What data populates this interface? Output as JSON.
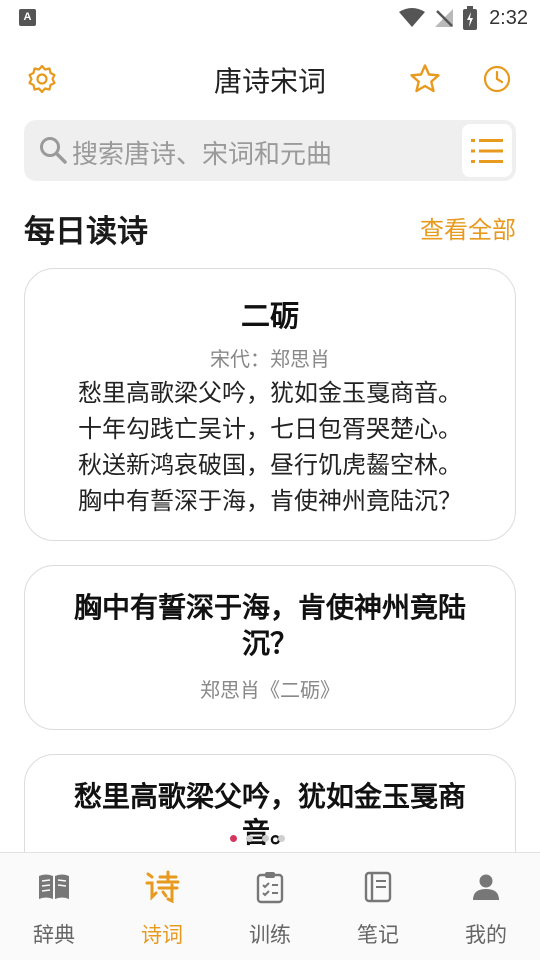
{
  "status_bar": {
    "time": "2:32",
    "left_badge": "A"
  },
  "app_bar": {
    "title": "唐诗宋词"
  },
  "search": {
    "placeholder": "搜索唐诗、宋词和元曲"
  },
  "section": {
    "heading": "每日读诗",
    "view_all": "查看全部"
  },
  "daily_poem": {
    "title": "二砺",
    "author_line": "宋代：郑思肖",
    "lines": [
      "愁里高歌梁父吟，犹如金玉戛商音。",
      "十年勾践亡吴计，七日包胥哭楚心。",
      "秋送新鸿哀破国，昼行饥虎齧空林。",
      "胸中有誓深于海，肯使神州竟陆沉？"
    ]
  },
  "quote_cards": [
    {
      "quote": "胸中有誓深于海，肯使神州竟陆沉？",
      "source": "郑思肖《二砺》"
    },
    {
      "quote": "愁里高歌梁父吟，犹如金玉戛商音。"
    }
  ],
  "carousel": {
    "pages": 4,
    "active_index": 0
  },
  "bottom_nav": {
    "items": [
      {
        "label": "辞典",
        "icon": "book-icon"
      },
      {
        "label": "诗词",
        "icon": "poem-icon",
        "active": true
      },
      {
        "label": "训练",
        "icon": "clipboard-icon"
      },
      {
        "label": "笔记",
        "icon": "notebook-icon"
      },
      {
        "label": "我的",
        "icon": "person-icon"
      }
    ]
  },
  "colors": {
    "accent": "#e79a1e",
    "dot_active": "#d4365d",
    "search_bg": "#efefef"
  }
}
